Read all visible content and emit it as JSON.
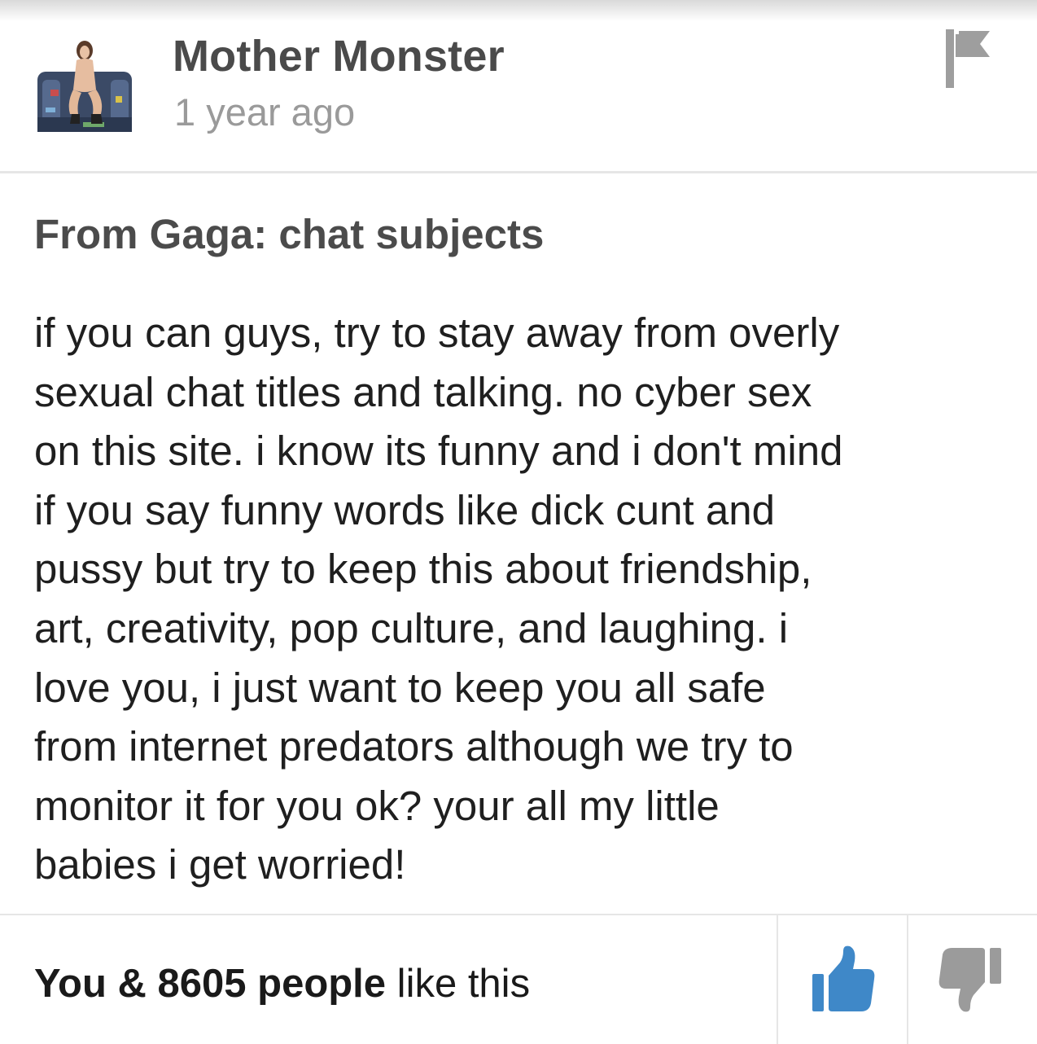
{
  "post": {
    "author": {
      "name": "Mother Monster",
      "avatar_icon": "user-avatar-photo"
    },
    "timestamp": "1 year ago",
    "title": "From Gaga: chat subjects",
    "body_lines": [
      "if you can guys, try to stay away from overly",
      "sexual chat titles and talking. no cyber sex",
      "on this site. i know its funny and i don't mind",
      "if you say funny words like dick cunt and",
      "pussy but try to keep this about friendship,",
      "art, creativity, pop culture, and laughing. i",
      "love you, i just want to keep you all safe",
      "from internet predators although we try to",
      "monitor it for you ok? your all my little",
      "babies i get worried!"
    ]
  },
  "footer": {
    "likes_strong": "You & 8605 people",
    "likes_rest": " like this",
    "like_icon": "thumbs-up-icon",
    "dislike_icon": "thumbs-down-icon"
  },
  "icons": {
    "flag": "flag-icon"
  },
  "colors": {
    "like_blue": "#3f88c8",
    "dislike_gray": "#9b9b9b",
    "flag_gray": "#9e9e9e",
    "title_gray": "#4b4b4b",
    "timestamp_gray": "#9a9a9a"
  }
}
